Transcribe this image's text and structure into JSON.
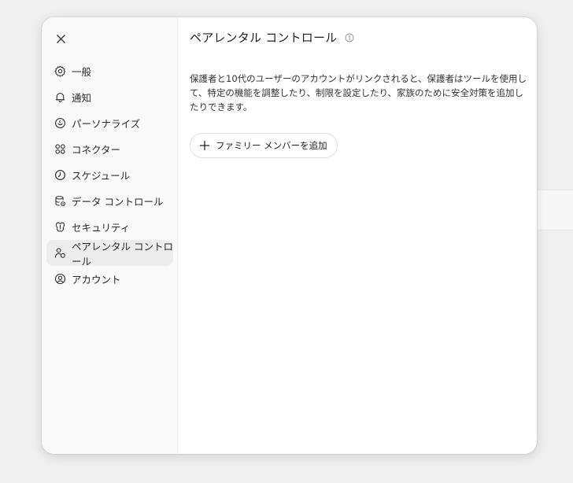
{
  "sidebar": {
    "close_icon": "close-icon",
    "items": [
      {
        "label": "一般",
        "icon": "gear-icon",
        "active": false
      },
      {
        "label": "通知",
        "icon": "bell-icon",
        "active": false
      },
      {
        "label": "パーソナライズ",
        "icon": "personalize-icon",
        "active": false
      },
      {
        "label": "コネクター",
        "icon": "connector-icon",
        "active": false
      },
      {
        "label": "スケジュール",
        "icon": "clock-icon",
        "active": false
      },
      {
        "label": "データ コントロール",
        "icon": "database-icon",
        "active": false
      },
      {
        "label": "セキュリティ",
        "icon": "shield-icon",
        "active": false
      },
      {
        "label": "ペアレンタル コントロール",
        "icon": "parental-icon",
        "active": true
      },
      {
        "label": "アカウント",
        "icon": "account-icon",
        "active": false
      }
    ]
  },
  "main": {
    "title": "ペアレンタル コントロール",
    "info_icon": "info-icon",
    "description": "保護者と10代のユーザーのアカウントがリンクされると、保護者はツールを使用して、特定の機能を調整したり、制限を設定したり、家族のために安全対策を追加したりできます。",
    "add_button_label": "ファミリー メンバーを追加",
    "add_button_icon": "plus-icon"
  },
  "colors": {
    "background": "#efefef",
    "dialog": "#ffffff",
    "sidebar": "#f9f9f9",
    "active_item": "#ececec"
  }
}
